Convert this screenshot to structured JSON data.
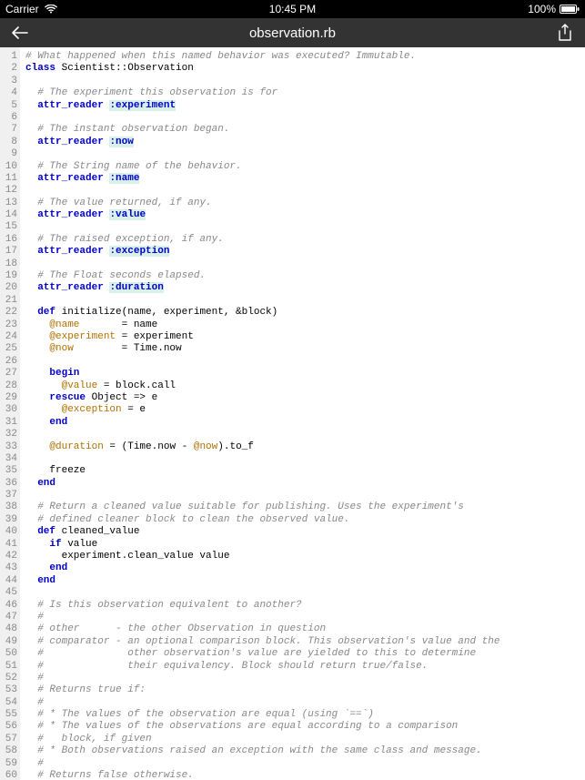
{
  "status": {
    "carrier": "Carrier",
    "time": "10:45 PM",
    "battery": "100%"
  },
  "nav": {
    "title": "observation.rb"
  },
  "code": {
    "lines": [
      [
        [
          "c-comment",
          "# What happened when this named behavior was executed? Immutable."
        ]
      ],
      [
        [
          "c-kw",
          "class"
        ],
        [
          "",
          " Scientist::Observation"
        ]
      ],
      [],
      [
        [
          "",
          "  "
        ],
        [
          "c-comment",
          "# The experiment this observation is for"
        ]
      ],
      [
        [
          "",
          "  "
        ],
        [
          "c-kw",
          "attr_reader"
        ],
        [
          "",
          " "
        ],
        [
          "c-sym",
          ":experiment"
        ]
      ],
      [],
      [
        [
          "",
          "  "
        ],
        [
          "c-comment",
          "# The instant observation began."
        ]
      ],
      [
        [
          "",
          "  "
        ],
        [
          "c-kw",
          "attr_reader"
        ],
        [
          "",
          " "
        ],
        [
          "c-sym",
          ":now"
        ]
      ],
      [],
      [
        [
          "",
          "  "
        ],
        [
          "c-comment",
          "# The String name of the behavior."
        ]
      ],
      [
        [
          "",
          "  "
        ],
        [
          "c-kw",
          "attr_reader"
        ],
        [
          "",
          " "
        ],
        [
          "c-sym",
          ":name"
        ]
      ],
      [],
      [
        [
          "",
          "  "
        ],
        [
          "c-comment",
          "# The value returned, if any."
        ]
      ],
      [
        [
          "",
          "  "
        ],
        [
          "c-kw",
          "attr_reader"
        ],
        [
          "",
          " "
        ],
        [
          "c-sym",
          ":value"
        ]
      ],
      [],
      [
        [
          "",
          "  "
        ],
        [
          "c-comment",
          "# The raised exception, if any."
        ]
      ],
      [
        [
          "",
          "  "
        ],
        [
          "c-kw",
          "attr_reader"
        ],
        [
          "",
          " "
        ],
        [
          "c-sym",
          ":exception"
        ]
      ],
      [],
      [
        [
          "",
          "  "
        ],
        [
          "c-comment",
          "# The Float seconds elapsed."
        ]
      ],
      [
        [
          "",
          "  "
        ],
        [
          "c-kw",
          "attr_reader"
        ],
        [
          "",
          " "
        ],
        [
          "c-sym",
          ":duration"
        ]
      ],
      [],
      [
        [
          "",
          "  "
        ],
        [
          "c-kw",
          "def"
        ],
        [
          "",
          " initialize(name, experiment, &block)"
        ]
      ],
      [
        [
          "",
          "    "
        ],
        [
          "c-ivar",
          "@name"
        ],
        [
          "",
          "       = name"
        ]
      ],
      [
        [
          "",
          "    "
        ],
        [
          "c-ivar",
          "@experiment"
        ],
        [
          "",
          " = experiment"
        ]
      ],
      [
        [
          "",
          "    "
        ],
        [
          "c-ivar",
          "@now"
        ],
        [
          "",
          "        = Time.now"
        ]
      ],
      [],
      [
        [
          "",
          "    "
        ],
        [
          "c-kw",
          "begin"
        ]
      ],
      [
        [
          "",
          "      "
        ],
        [
          "c-ivar",
          "@value"
        ],
        [
          "",
          " = block.call"
        ]
      ],
      [
        [
          "",
          "    "
        ],
        [
          "c-kw",
          "rescue"
        ],
        [
          "",
          " Object => e"
        ]
      ],
      [
        [
          "",
          "      "
        ],
        [
          "c-ivar",
          "@exception"
        ],
        [
          "",
          " = e"
        ]
      ],
      [
        [
          "",
          "    "
        ],
        [
          "c-kw",
          "end"
        ]
      ],
      [],
      [
        [
          "",
          "    "
        ],
        [
          "c-ivar",
          "@duration"
        ],
        [
          "",
          " = (Time.now - "
        ],
        [
          "c-ivar",
          "@now"
        ],
        [
          "",
          ").to_f"
        ]
      ],
      [],
      [
        [
          "",
          "    freeze"
        ]
      ],
      [
        [
          "",
          "  "
        ],
        [
          "c-kw",
          "end"
        ]
      ],
      [],
      [
        [
          "",
          "  "
        ],
        [
          "c-comment",
          "# Return a cleaned value suitable for publishing. Uses the experiment's"
        ]
      ],
      [
        [
          "",
          "  "
        ],
        [
          "c-comment",
          "# defined cleaner block to clean the observed value."
        ]
      ],
      [
        [
          "",
          "  "
        ],
        [
          "c-kw",
          "def"
        ],
        [
          "",
          " cleaned_value"
        ]
      ],
      [
        [
          "",
          "    "
        ],
        [
          "c-kw",
          "if"
        ],
        [
          "",
          " value"
        ]
      ],
      [
        [
          "",
          "      experiment.clean_value value"
        ]
      ],
      [
        [
          "",
          "    "
        ],
        [
          "c-kw",
          "end"
        ]
      ],
      [
        [
          "",
          "  "
        ],
        [
          "c-kw",
          "end"
        ]
      ],
      [],
      [
        [
          "",
          "  "
        ],
        [
          "c-comment",
          "# Is this observation equivalent to another?"
        ]
      ],
      [
        [
          "",
          "  "
        ],
        [
          "c-comment",
          "#"
        ]
      ],
      [
        [
          "",
          "  "
        ],
        [
          "c-comment",
          "# other      - the other Observation in question"
        ]
      ],
      [
        [
          "",
          "  "
        ],
        [
          "c-comment",
          "# comparator - an optional comparison block. This observation's value and the"
        ]
      ],
      [
        [
          "",
          "  "
        ],
        [
          "c-comment",
          "#              other observation's value are yielded to this to determine"
        ]
      ],
      [
        [
          "",
          "  "
        ],
        [
          "c-comment",
          "#              their equivalency. Block should return true/false."
        ]
      ],
      [
        [
          "",
          "  "
        ],
        [
          "c-comment",
          "#"
        ]
      ],
      [
        [
          "",
          "  "
        ],
        [
          "c-comment",
          "# Returns true if:"
        ]
      ],
      [
        [
          "",
          "  "
        ],
        [
          "c-comment",
          "#"
        ]
      ],
      [
        [
          "",
          "  "
        ],
        [
          "c-comment",
          "# * The values of the observation are equal (using `==`)"
        ]
      ],
      [
        [
          "",
          "  "
        ],
        [
          "c-comment",
          "# * The values of the observations are equal according to a comparison"
        ]
      ],
      [
        [
          "",
          "  "
        ],
        [
          "c-comment",
          "#   block, if given"
        ]
      ],
      [
        [
          "",
          "  "
        ],
        [
          "c-comment",
          "# * Both observations raised an exception with the same class and message."
        ]
      ],
      [
        [
          "",
          "  "
        ],
        [
          "c-comment",
          "#"
        ]
      ],
      [
        [
          "",
          "  "
        ],
        [
          "c-comment",
          "# Returns false otherwise."
        ]
      ]
    ]
  }
}
